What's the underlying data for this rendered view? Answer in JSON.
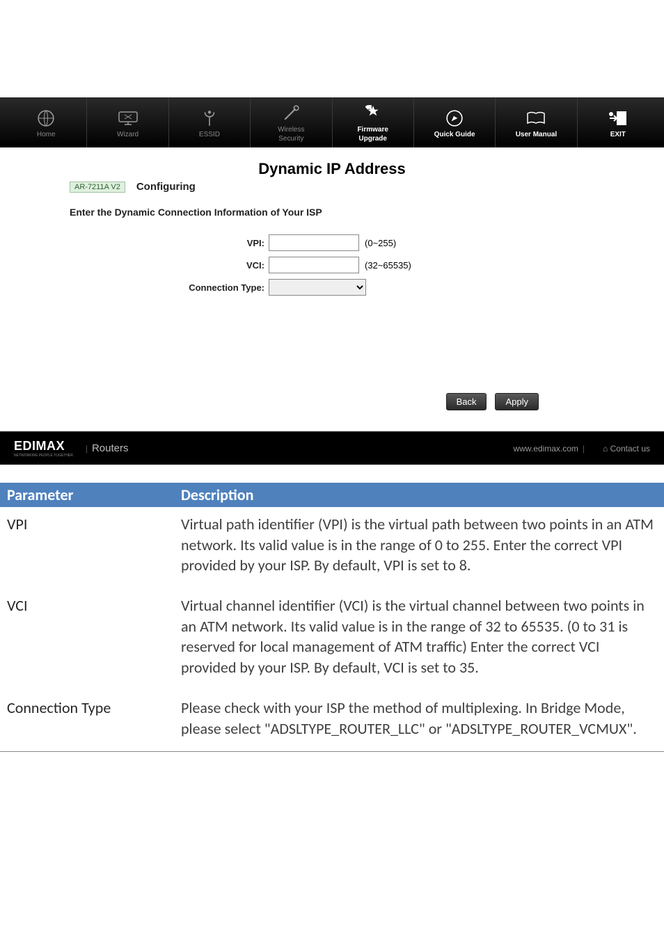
{
  "nav": {
    "home": "Home",
    "wizard": "Wizard",
    "essid": "ESSID",
    "wireless_top": "Wireless",
    "wireless_bot": "Security",
    "firmware_top": "Firmware",
    "firmware_bot": "Upgrade",
    "quick_guide": "Quick Guide",
    "user_manual": "User Manual",
    "exit": "EXIT"
  },
  "page": {
    "title": "Dynamic IP Address",
    "model": "AR-7211A V2",
    "subtitle": "Configuring",
    "info": "Enter the Dynamic Connection Information of Your ISP",
    "vpi_label": "VPI:",
    "vpi_value": "",
    "vpi_range": "(0~255)",
    "vci_label": "VCI:",
    "vci_value": "",
    "vci_range": "(32~65535)",
    "conn_label": "Connection Type:",
    "back": "Back",
    "apply": "Apply"
  },
  "footer": {
    "brand": "EDIMAX",
    "brand_sub": "NETWORKING PEOPLE TOGETHER",
    "section": "Routers",
    "url": "www.edimax.com",
    "contact": "Contact us"
  },
  "table": {
    "h_param": "Parameter",
    "h_desc": "Description",
    "rows": [
      {
        "param": "VPI",
        "desc": "Virtual path identifier (VPI) is the virtual path between two points in an ATM network. Its valid value is in the range of 0 to 255. Enter the correct VPI provided by your ISP. By default, VPI is set to 8."
      },
      {
        "param": "VCI",
        "desc": "Virtual channel identifier (VCI) is the virtual channel between two points in an ATM network. Its valid value is in the range of 32 to 65535. (0 to 31 is reserved for local management of ATM traffic) Enter the correct VCI provided by your ISP. By default, VCI is set to 35."
      },
      {
        "param": "Connection Type",
        "desc": "Please check with your ISP the method of multiplexing. In Bridge Mode, please select \"ADSLTYPE_ROUTER_LLC\" or \"ADSLTYPE_ROUTER_VCMUX\"."
      }
    ]
  }
}
